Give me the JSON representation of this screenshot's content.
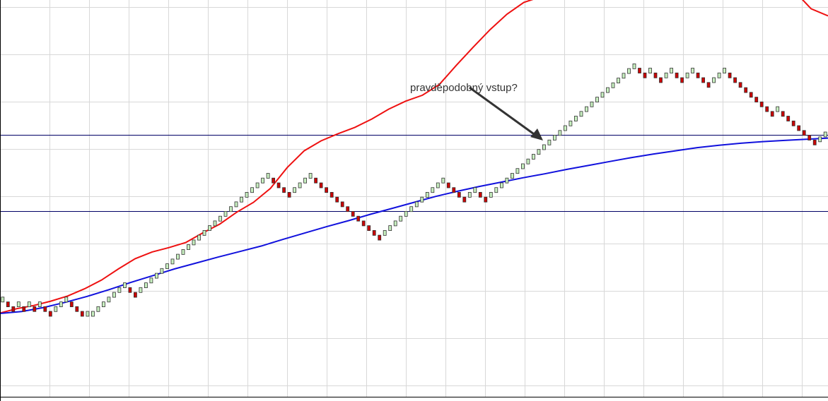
{
  "chart_data": {
    "type": "renko",
    "title": "",
    "xlabel": "",
    "ylabel": "",
    "ylim": [
      0,
      1
    ],
    "grid": true,
    "colors": {
      "background": "#ffffff",
      "grid": "#d8d8d8",
      "up_brick": "#c8f0c0",
      "down_brick": "#cc0000",
      "brick_border": "#333333",
      "ma_fast": "#ee1111",
      "ma_slow": "#1111dd",
      "horizontal_line": "#000066",
      "annotation": "#333333"
    },
    "bricks": [
      0.245,
      0.233,
      0.221,
      0.233,
      0.221,
      0.233,
      0.221,
      0.233,
      0.221,
      0.209,
      0.221,
      0.233,
      0.245,
      0.233,
      0.221,
      0.209,
      0.209,
      0.209,
      0.221,
      0.233,
      0.245,
      0.257,
      0.269,
      0.281,
      0.269,
      0.257,
      0.269,
      0.281,
      0.293,
      0.305,
      0.317,
      0.329,
      0.341,
      0.353,
      0.365,
      0.377,
      0.389,
      0.401,
      0.413,
      0.425,
      0.437,
      0.449,
      0.461,
      0.473,
      0.485,
      0.497,
      0.509,
      0.521,
      0.533,
      0.545,
      0.557,
      0.545,
      0.533,
      0.521,
      0.509,
      0.521,
      0.533,
      0.545,
      0.557,
      0.545,
      0.533,
      0.521,
      0.509,
      0.497,
      0.485,
      0.473,
      0.461,
      0.449,
      0.437,
      0.425,
      0.413,
      0.401,
      0.413,
      0.425,
      0.437,
      0.449,
      0.461,
      0.473,
      0.485,
      0.497,
      0.509,
      0.521,
      0.533,
      0.545,
      0.533,
      0.521,
      0.509,
      0.497,
      0.509,
      0.521,
      0.509,
      0.497,
      0.509,
      0.521,
      0.533,
      0.545,
      0.557,
      0.569,
      0.581,
      0.593,
      0.605,
      0.617,
      0.629,
      0.641,
      0.653,
      0.665,
      0.677,
      0.689,
      0.701,
      0.713,
      0.725,
      0.737,
      0.749,
      0.761,
      0.773,
      0.785,
      0.797,
      0.809,
      0.821,
      0.833,
      0.822,
      0.81,
      0.822,
      0.81,
      0.798,
      0.81,
      0.822,
      0.81,
      0.798,
      0.81,
      0.822,
      0.81,
      0.798,
      0.786,
      0.798,
      0.81,
      0.822,
      0.81,
      0.798,
      0.786,
      0.773,
      0.761,
      0.749,
      0.737,
      0.725,
      0.713,
      0.725,
      0.713,
      0.701,
      0.689,
      0.677,
      0.665,
      0.653,
      0.641,
      0.649,
      0.661
    ],
    "series": [
      {
        "kind": "moving_average",
        "values": [
          0.211,
          0.222,
          0.23,
          0.241,
          0.254,
          0.272,
          0.294,
          0.322,
          0.348,
          0.365,
          0.376,
          0.389,
          0.413,
          0.435,
          0.465,
          0.49,
          0.525,
          0.578,
          0.62,
          0.645,
          0.663,
          0.679,
          0.7,
          0.725,
          0.745,
          0.76,
          0.787,
          0.835,
          0.881,
          0.925,
          0.964,
          0.994,
          1.008,
          1.045,
          1.08,
          1.11,
          1.135,
          1.15,
          1.15,
          1.18,
          1.2,
          1.203,
          1.192,
          1.17,
          1.137,
          1.105,
          1.072,
          1.023,
          0.978,
          0.96
        ]
      },
      {
        "kind": "moving_average",
        "values": [
          0.21,
          0.215,
          0.225,
          0.238,
          0.253,
          0.27,
          0.288,
          0.305,
          0.322,
          0.337,
          0.352,
          0.366,
          0.38,
          0.397,
          0.413,
          0.429,
          0.444,
          0.46,
          0.475,
          0.49,
          0.505,
          0.518,
          0.53,
          0.541,
          0.552,
          0.562,
          0.573,
          0.583,
          0.593,
          0.603,
          0.612,
          0.62,
          0.628,
          0.634,
          0.639,
          0.643,
          0.646,
          0.649,
          0.652
        ]
      }
    ],
    "horizontal_lines": [
      0.661,
      0.468
    ],
    "annotation": {
      "text": "pravděpodobný vstup?"
    }
  }
}
